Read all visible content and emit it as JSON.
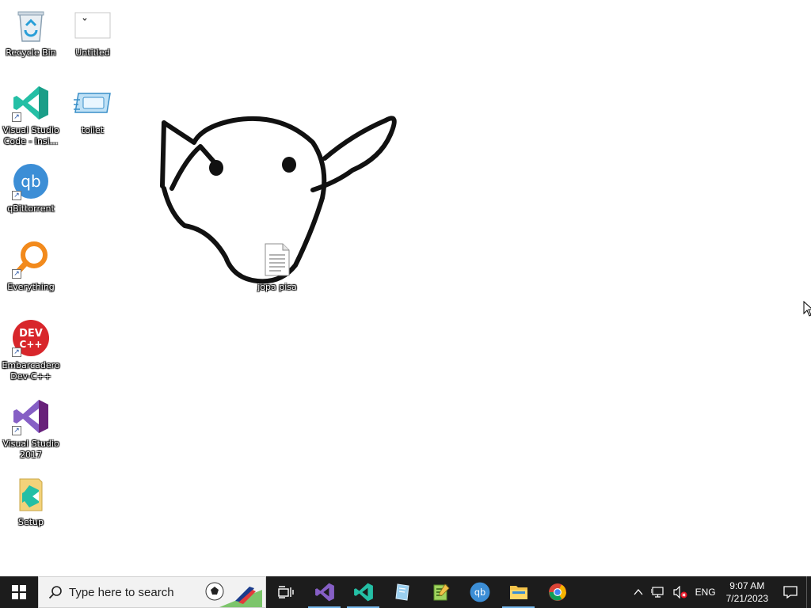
{
  "desktop": {
    "icons": [
      {
        "id": "recycle-bin",
        "label": "Recycle Bin"
      },
      {
        "id": "untitled",
        "label": "Untitled"
      },
      {
        "id": "vscode-insiders",
        "label": "Visual Studio Code - Insi..."
      },
      {
        "id": "toilet",
        "label": "toilet"
      },
      {
        "id": "qbittorrent",
        "label": "qBittorrent"
      },
      {
        "id": "everything",
        "label": "Everything"
      },
      {
        "id": "devcpp",
        "label": "Embarcadero Dev-C++"
      },
      {
        "id": "visual-studio-2017",
        "label": "Visual Studio 2017"
      },
      {
        "id": "setup",
        "label": "Setup"
      },
      {
        "id": "jopa-pisa",
        "label": "jopa pisa"
      }
    ]
  },
  "taskbar": {
    "search_placeholder": "Type here to search",
    "apps": [
      {
        "icon": "task-view-icon",
        "label": "Task View"
      },
      {
        "icon": "visual-studio-icon",
        "label": "Visual Studio"
      },
      {
        "icon": "vscode-icon",
        "label": "Visual Studio Code"
      },
      {
        "icon": "disk-tool-icon",
        "label": "Disk tool"
      },
      {
        "icon": "notepad-plus-icon",
        "label": "Notepad++"
      },
      {
        "icon": "qbittorrent-icon",
        "label": "qBittorrent"
      },
      {
        "icon": "file-explorer-icon",
        "label": "File Explorer"
      },
      {
        "icon": "chrome-icon",
        "label": "Google Chrome"
      }
    ],
    "tray": {
      "language": "ENG",
      "time": "9:07 AM",
      "date": "7/21/2023"
    }
  },
  "colors": {
    "taskbar_bg": "#1c1c1c",
    "accent": "#76b9ed",
    "desktop_bg": "#ffffff"
  }
}
